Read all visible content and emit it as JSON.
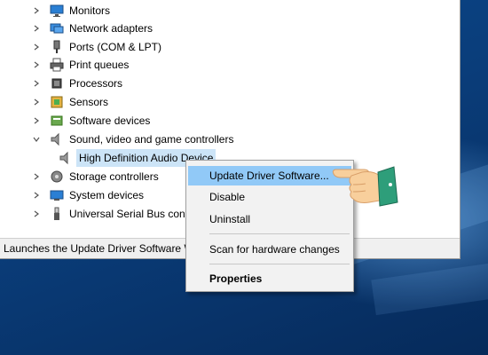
{
  "tree": {
    "items": [
      {
        "label": "Monitors",
        "expanded": false,
        "icon": "monitor-icon"
      },
      {
        "label": "Network adapters",
        "expanded": false,
        "icon": "network-adapter-icon"
      },
      {
        "label": "Ports (COM & LPT)",
        "expanded": false,
        "icon": "port-icon"
      },
      {
        "label": "Print queues",
        "expanded": false,
        "icon": "printer-icon"
      },
      {
        "label": "Processors",
        "expanded": false,
        "icon": "processor-icon"
      },
      {
        "label": "Sensors",
        "expanded": false,
        "icon": "sensor-icon"
      },
      {
        "label": "Software devices",
        "expanded": false,
        "icon": "software-device-icon"
      },
      {
        "label": "Sound, video and game controllers",
        "expanded": true,
        "icon": "speaker-icon"
      },
      {
        "label": "Storage controllers",
        "expanded": false,
        "icon": "storage-controller-icon"
      },
      {
        "label": "System devices",
        "expanded": false,
        "icon": "system-device-icon"
      },
      {
        "label": "Universal Serial Bus controllers",
        "expanded": false,
        "icon": "usb-icon"
      }
    ],
    "child": {
      "label": "High Definition Audio Device",
      "icon": "speaker-icon"
    }
  },
  "statusbar": {
    "text": "Launches the Update Driver Software Wizard"
  },
  "context_menu": {
    "items": [
      {
        "label": "Update Driver Software...",
        "highlighted": true
      },
      {
        "label": "Disable"
      },
      {
        "label": "Uninstall"
      },
      {
        "label": "Scan for hardware changes"
      },
      {
        "label": "Properties",
        "bold": true
      }
    ]
  },
  "colors": {
    "menu_highlight": "#91c9f7",
    "selection": "#cce4f7",
    "desktop": "#0a3d7a"
  }
}
